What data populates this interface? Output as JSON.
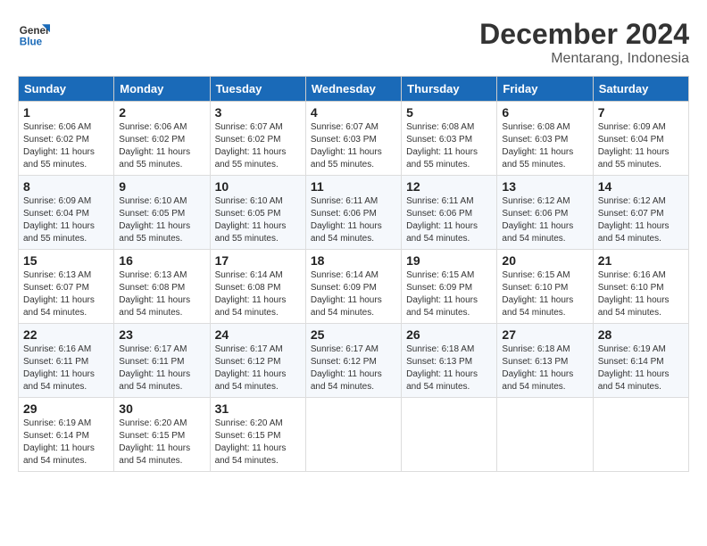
{
  "logo": {
    "text_general": "General",
    "text_blue": "Blue"
  },
  "title": "December 2024",
  "location": "Mentarang, Indonesia",
  "days_of_week": [
    "Sunday",
    "Monday",
    "Tuesday",
    "Wednesday",
    "Thursday",
    "Friday",
    "Saturday"
  ],
  "weeks": [
    [
      {
        "day": "1",
        "sunrise": "6:06 AM",
        "sunset": "6:02 PM",
        "daylight": "11 hours and 55 minutes."
      },
      {
        "day": "2",
        "sunrise": "6:06 AM",
        "sunset": "6:02 PM",
        "daylight": "11 hours and 55 minutes."
      },
      {
        "day": "3",
        "sunrise": "6:07 AM",
        "sunset": "6:02 PM",
        "daylight": "11 hours and 55 minutes."
      },
      {
        "day": "4",
        "sunrise": "6:07 AM",
        "sunset": "6:03 PM",
        "daylight": "11 hours and 55 minutes."
      },
      {
        "day": "5",
        "sunrise": "6:08 AM",
        "sunset": "6:03 PM",
        "daylight": "11 hours and 55 minutes."
      },
      {
        "day": "6",
        "sunrise": "6:08 AM",
        "sunset": "6:03 PM",
        "daylight": "11 hours and 55 minutes."
      },
      {
        "day": "7",
        "sunrise": "6:09 AM",
        "sunset": "6:04 PM",
        "daylight": "11 hours and 55 minutes."
      }
    ],
    [
      {
        "day": "8",
        "sunrise": "6:09 AM",
        "sunset": "6:04 PM",
        "daylight": "11 hours and 55 minutes."
      },
      {
        "day": "9",
        "sunrise": "6:10 AM",
        "sunset": "6:05 PM",
        "daylight": "11 hours and 55 minutes."
      },
      {
        "day": "10",
        "sunrise": "6:10 AM",
        "sunset": "6:05 PM",
        "daylight": "11 hours and 55 minutes."
      },
      {
        "day": "11",
        "sunrise": "6:11 AM",
        "sunset": "6:06 PM",
        "daylight": "11 hours and 54 minutes."
      },
      {
        "day": "12",
        "sunrise": "6:11 AM",
        "sunset": "6:06 PM",
        "daylight": "11 hours and 54 minutes."
      },
      {
        "day": "13",
        "sunrise": "6:12 AM",
        "sunset": "6:06 PM",
        "daylight": "11 hours and 54 minutes."
      },
      {
        "day": "14",
        "sunrise": "6:12 AM",
        "sunset": "6:07 PM",
        "daylight": "11 hours and 54 minutes."
      }
    ],
    [
      {
        "day": "15",
        "sunrise": "6:13 AM",
        "sunset": "6:07 PM",
        "daylight": "11 hours and 54 minutes."
      },
      {
        "day": "16",
        "sunrise": "6:13 AM",
        "sunset": "6:08 PM",
        "daylight": "11 hours and 54 minutes."
      },
      {
        "day": "17",
        "sunrise": "6:14 AM",
        "sunset": "6:08 PM",
        "daylight": "11 hours and 54 minutes."
      },
      {
        "day": "18",
        "sunrise": "6:14 AM",
        "sunset": "6:09 PM",
        "daylight": "11 hours and 54 minutes."
      },
      {
        "day": "19",
        "sunrise": "6:15 AM",
        "sunset": "6:09 PM",
        "daylight": "11 hours and 54 minutes."
      },
      {
        "day": "20",
        "sunrise": "6:15 AM",
        "sunset": "6:10 PM",
        "daylight": "11 hours and 54 minutes."
      },
      {
        "day": "21",
        "sunrise": "6:16 AM",
        "sunset": "6:10 PM",
        "daylight": "11 hours and 54 minutes."
      }
    ],
    [
      {
        "day": "22",
        "sunrise": "6:16 AM",
        "sunset": "6:11 PM",
        "daylight": "11 hours and 54 minutes."
      },
      {
        "day": "23",
        "sunrise": "6:17 AM",
        "sunset": "6:11 PM",
        "daylight": "11 hours and 54 minutes."
      },
      {
        "day": "24",
        "sunrise": "6:17 AM",
        "sunset": "6:12 PM",
        "daylight": "11 hours and 54 minutes."
      },
      {
        "day": "25",
        "sunrise": "6:17 AM",
        "sunset": "6:12 PM",
        "daylight": "11 hours and 54 minutes."
      },
      {
        "day": "26",
        "sunrise": "6:18 AM",
        "sunset": "6:13 PM",
        "daylight": "11 hours and 54 minutes."
      },
      {
        "day": "27",
        "sunrise": "6:18 AM",
        "sunset": "6:13 PM",
        "daylight": "11 hours and 54 minutes."
      },
      {
        "day": "28",
        "sunrise": "6:19 AM",
        "sunset": "6:14 PM",
        "daylight": "11 hours and 54 minutes."
      }
    ],
    [
      {
        "day": "29",
        "sunrise": "6:19 AM",
        "sunset": "6:14 PM",
        "daylight": "11 hours and 54 minutes."
      },
      {
        "day": "30",
        "sunrise": "6:20 AM",
        "sunset": "6:15 PM",
        "daylight": "11 hours and 54 minutes."
      },
      {
        "day": "31",
        "sunrise": "6:20 AM",
        "sunset": "6:15 PM",
        "daylight": "11 hours and 54 minutes."
      },
      null,
      null,
      null,
      null
    ]
  ],
  "label_sunrise": "Sunrise:",
  "label_sunset": "Sunset:",
  "label_daylight": "Daylight:"
}
